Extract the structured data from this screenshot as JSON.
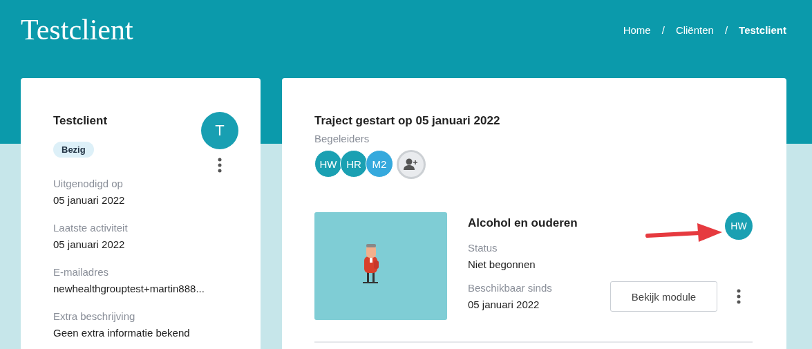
{
  "page_title": "Testclient",
  "breadcrumb": [
    {
      "label": "Home",
      "current": false
    },
    {
      "label": "Cliënten",
      "current": false
    },
    {
      "label": "Testclient",
      "current": true
    }
  ],
  "breadcrumb_separator": "/",
  "client_card": {
    "name": "Testclient",
    "status": "Bezig",
    "avatar": "T",
    "fields": [
      {
        "label": "Uitgenodigd op",
        "value": "05 januari 2022"
      },
      {
        "label": "Laatste activiteit",
        "value": "05 januari 2022"
      },
      {
        "label": "E-mailadres",
        "value": "newhealthgrouptest+martin888..."
      },
      {
        "label": "Extra beschrijving",
        "value": "Geen extra informatie bekend"
      }
    ]
  },
  "trajectory": {
    "title": "Traject gestart op 05 januari 2022",
    "supervisors_label": "Begeleiders",
    "supervisors": [
      {
        "initials": "HW",
        "color": "#1aa0b2"
      },
      {
        "initials": "HR",
        "color": "#1aa0b2"
      },
      {
        "initials": "M2",
        "color": "#35a9dd"
      }
    ],
    "modules": [
      {
        "title": "Alcohol en ouderen",
        "assignee": "HW",
        "status_label": "Status",
        "status": "Niet begonnen",
        "available_label": "Beschikbaar sinds",
        "available": "05 januari 2022",
        "button": "Bekijk module"
      }
    ]
  }
}
